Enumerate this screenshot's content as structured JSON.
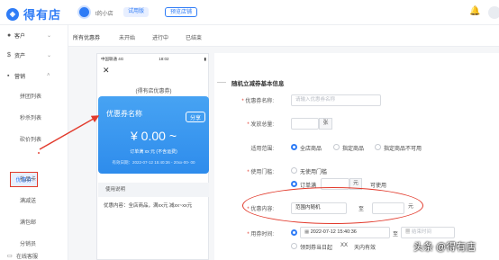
{
  "app": {
    "brand": "得有店",
    "logo_icon": "store-logo-icon"
  },
  "header": {
    "shop_name": "t的小店",
    "trial_badge": "试用版",
    "preview_button": "预览店铺"
  },
  "sidebar": {
    "customers": "客户",
    "assets": "资产",
    "marketing": "营销",
    "sub_items": [
      "拼团列表",
      "秒杀列表",
      "砍价列表",
      "优惠券",
      "礼品卡",
      "满减送",
      "满包邮",
      "分销员"
    ],
    "active_item": "优惠券",
    "online_service": "在线客服"
  },
  "tabs": [
    "所有优惠券",
    "未开始",
    "进行中",
    "已结束"
  ],
  "phone": {
    "carrier": "中国联通 4G",
    "time": "18:02",
    "page_title": "(得有店优惠券)",
    "coupon_name": "优惠券名称",
    "share": "分享",
    "amount": "¥ 0.00 ~",
    "condition": "订单满 xx 元 (不含运费)",
    "validity": "有效日期：2022-07-12 15:40:36 - 20xx-00- 00",
    "usage_title": "使用说明",
    "usage_text": "优惠内容：全店商品，满xx元 减xx~xx元"
  },
  "form": {
    "section_title": "随机立减券基本信息",
    "name_label": "优惠券名称:",
    "name_placeholder": "请输入优惠券名称",
    "total_label": "发放总量:",
    "total_unit": "张",
    "scope_label": "适用范围:",
    "scope_options": [
      "全店商品",
      "指定商品",
      "指定商品不可用"
    ],
    "threshold_label": "使用门槛:",
    "threshold_none": "无使用门槛",
    "threshold_order": "订单满",
    "threshold_unit": "元",
    "threshold_suffix": "可使用",
    "content_label": "优惠内容:",
    "content_prefix": "范围内随机",
    "content_to": "至",
    "content_unit": "元",
    "time_label": "用券时间:",
    "time_start": "2022-07-12 15:40:36",
    "time_to": "至",
    "time_end_placeholder": "结束时间",
    "day_option": "领到券当日起",
    "day_value": "XX",
    "day_suffix": "天内有效"
  },
  "watermark": "头条 @得有店",
  "colors": {
    "accent": "#2f7cf6",
    "annotation": "#e23a2c"
  }
}
